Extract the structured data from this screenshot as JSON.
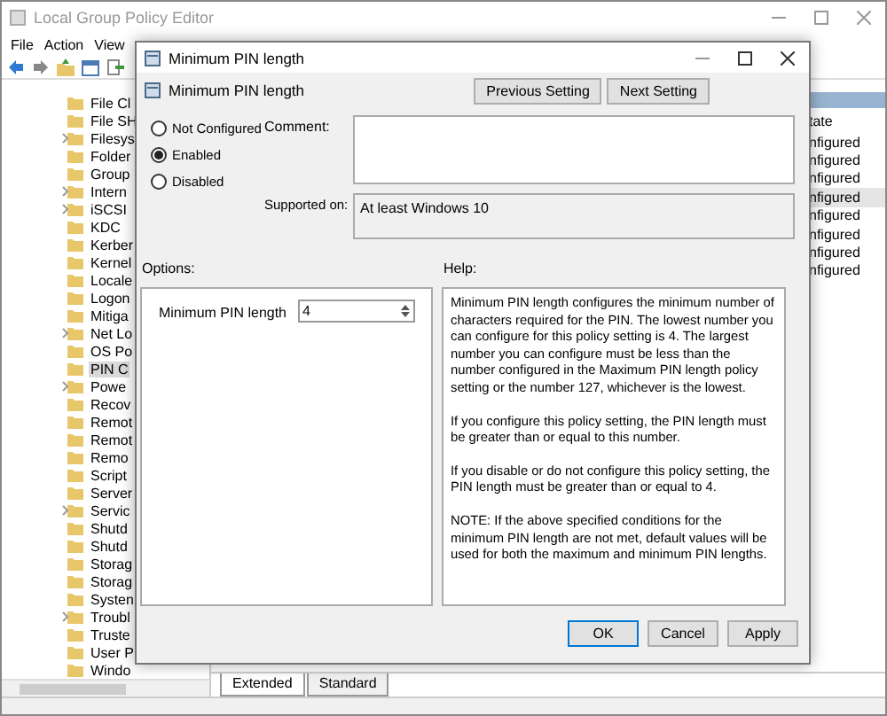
{
  "window": {
    "title": "Local Group Policy Editor"
  },
  "menu": [
    "File",
    "Action",
    "View"
  ],
  "tree": [
    {
      "label": "File Cl",
      "expandable": false,
      "selected": false
    },
    {
      "label": "File SH",
      "expandable": false,
      "selected": false
    },
    {
      "label": "Filesys",
      "expandable": true,
      "selected": false
    },
    {
      "label": "Folder",
      "expandable": false,
      "selected": false
    },
    {
      "label": "Group",
      "expandable": false,
      "selected": false
    },
    {
      "label": "Intern",
      "expandable": true,
      "selected": false
    },
    {
      "label": "iSCSI",
      "expandable": true,
      "selected": false
    },
    {
      "label": "KDC",
      "expandable": false,
      "selected": false
    },
    {
      "label": "Kerber",
      "expandable": false,
      "selected": false
    },
    {
      "label": "Kernel",
      "expandable": false,
      "selected": false
    },
    {
      "label": "Locale",
      "expandable": false,
      "selected": false
    },
    {
      "label": "Logon",
      "expandable": false,
      "selected": false
    },
    {
      "label": "Mitiga",
      "expandable": false,
      "selected": false
    },
    {
      "label": "Net Lo",
      "expandable": true,
      "selected": false
    },
    {
      "label": "OS Po",
      "expandable": false,
      "selected": false
    },
    {
      "label": "PIN C",
      "expandable": false,
      "selected": true
    },
    {
      "label": "Powe",
      "expandable": true,
      "selected": false
    },
    {
      "label": "Recov",
      "expandable": false,
      "selected": false
    },
    {
      "label": "Remot",
      "expandable": false,
      "selected": false
    },
    {
      "label": "Remot",
      "expandable": false,
      "selected": false
    },
    {
      "label": "Remo",
      "expandable": false,
      "selected": false
    },
    {
      "label": "Script",
      "expandable": false,
      "selected": false
    },
    {
      "label": "Server",
      "expandable": false,
      "selected": false
    },
    {
      "label": "Servic",
      "expandable": true,
      "selected": false
    },
    {
      "label": "Shutd",
      "expandable": false,
      "selected": false
    },
    {
      "label": "Shutd",
      "expandable": false,
      "selected": false
    },
    {
      "label": "Storag",
      "expandable": false,
      "selected": false
    },
    {
      "label": "Storag",
      "expandable": false,
      "selected": false
    },
    {
      "label": "Systen",
      "expandable": false,
      "selected": false
    },
    {
      "label": "Troubl",
      "expandable": true,
      "selected": false
    },
    {
      "label": "Truste",
      "expandable": false,
      "selected": false
    },
    {
      "label": "User P",
      "expandable": false,
      "selected": false
    },
    {
      "label": "Windo",
      "expandable": false,
      "selected": false
    }
  ],
  "list": {
    "column": "tate",
    "rows": [
      {
        "cell": "nfigured",
        "selected": false
      },
      {
        "cell": "nfigured",
        "selected": false
      },
      {
        "cell": "nfigured",
        "selected": false
      },
      {
        "cell": "nfigured",
        "selected": true
      },
      {
        "cell": "nfigured",
        "selected": false
      },
      {
        "cell": "nfigured",
        "selected": false
      },
      {
        "cell": "nfigured",
        "selected": false
      },
      {
        "cell": "nfigured",
        "selected": false
      }
    ]
  },
  "tabs": [
    {
      "label": "Extended",
      "selected": true
    },
    {
      "label": "Standard",
      "selected": false
    }
  ],
  "dialog": {
    "title": "Minimum PIN length",
    "heading": "Minimum PIN length",
    "nav_buttons": [
      "Previous Setting",
      "Next Setting"
    ],
    "radios": [
      {
        "label": "Not Configured",
        "selected": false
      },
      {
        "label": "Enabled",
        "selected": true
      },
      {
        "label": "Disabled",
        "selected": false
      }
    ],
    "comment_label": "Comment:",
    "supported_label": "Supported on:",
    "supported_value": "At least Windows 10",
    "options_label": "Options:",
    "help_label": "Help:",
    "option": {
      "label": "Minimum PIN length",
      "value": "4"
    },
    "help": [
      "Minimum PIN length configures the minimum number of characters required for the PIN.  The lowest number you can configure for this policy setting is 4.  The largest number you can configure must be less than the number configured in the Maximum PIN length policy setting or the number 127, whichever is the lowest.",
      "If you configure this policy setting, the PIN length must be greater than or equal to this number.",
      "If you disable or do not configure this policy setting, the PIN length must be greater than or equal to 4.",
      "NOTE: If the above specified conditions for the minimum PIN length are not met, default values will be used for both the maximum and minimum PIN lengths."
    ],
    "buttons": [
      {
        "label": "OK",
        "default": true
      },
      {
        "label": "Cancel",
        "default": false
      },
      {
        "label": "Apply",
        "default": false
      }
    ]
  }
}
